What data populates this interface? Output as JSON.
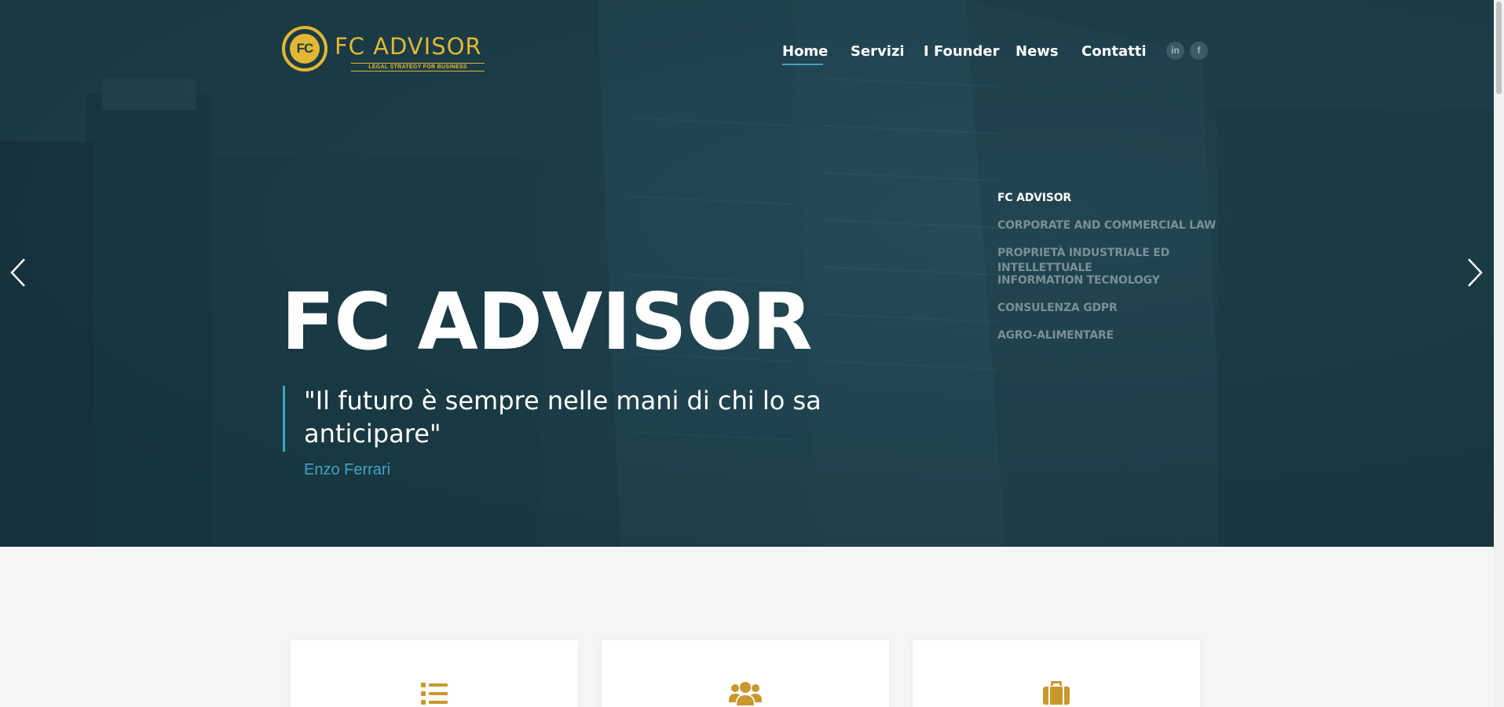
{
  "brand": {
    "logo_mark": "FC",
    "logo_name": "FC ADVISOR",
    "logo_tagline": "LEGAL STRATEGY FOR BUSINESS",
    "color_gold": "#e2b734"
  },
  "nav": {
    "items": [
      {
        "label": "Home",
        "active": true
      },
      {
        "label": "Servizi"
      },
      {
        "label": "I Founder"
      },
      {
        "label": "News"
      },
      {
        "label": "Contatti"
      }
    ],
    "social": [
      {
        "icon": "linkedin-icon",
        "glyph": "in"
      },
      {
        "icon": "facebook-icon",
        "glyph": "f"
      }
    ]
  },
  "hero": {
    "slide_menu": [
      {
        "label": "FC ADVISOR",
        "active": true
      },
      {
        "label": "CORPORATE AND COMMERCIAL LAW"
      },
      {
        "label": "PROPRIETÀ INDUSTRIALE ED INTELLETTUALE"
      },
      {
        "label": "INFORMATION TECNOLOGY"
      },
      {
        "label": "CONSULENZA GDPR"
      },
      {
        "label": "AGRO-ALIMENTARE"
      }
    ],
    "title": "FC ADVISOR",
    "quote": "\"Il futuro è sempre nelle mani di chi lo sa anticipare\"",
    "author": "Enzo Ferrari",
    "prev_icon": "chevron-left-icon",
    "next_icon": "chevron-right-icon",
    "accent": "#3fa3c4"
  },
  "features": {
    "cards": [
      {
        "icon": "list-icon"
      },
      {
        "icon": "users-icon"
      },
      {
        "icon": "briefcase-icon"
      }
    ]
  }
}
